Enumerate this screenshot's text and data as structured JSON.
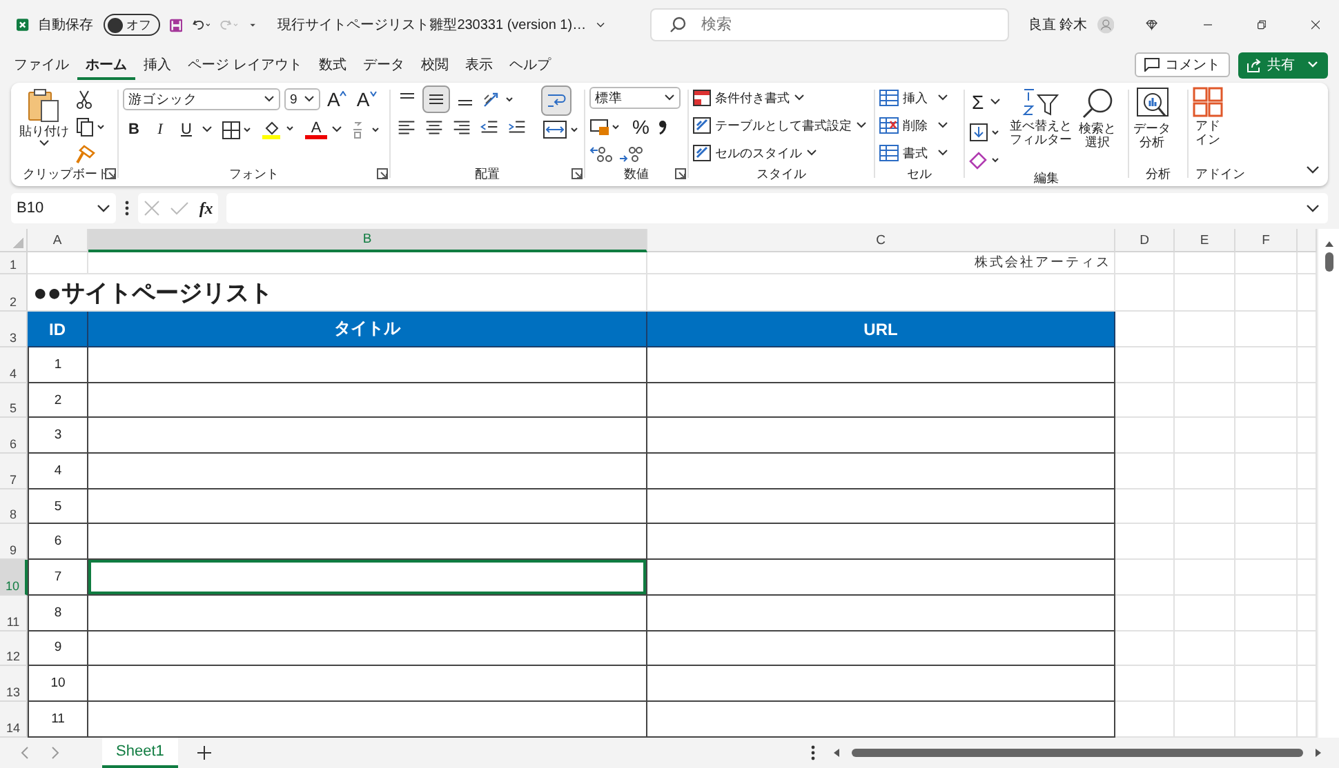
{
  "titlebar": {
    "autosave_label": "自動保存",
    "autosave": {
      "on": false,
      "label": "オフ"
    },
    "title": "現行サイトページリスト雛型230331 (version 1)…",
    "search": {
      "placeholder": "検索"
    },
    "user": "良直 鈴木"
  },
  "tabs": [
    {
      "label": "ファイル",
      "selected": false
    },
    {
      "label": "ホーム",
      "selected": true
    },
    {
      "label": "挿入",
      "selected": false
    },
    {
      "label": "ページ レイアウト",
      "selected": false
    },
    {
      "label": "数式",
      "selected": false
    },
    {
      "label": "データ",
      "selected": false
    },
    {
      "label": "校閲",
      "selected": false
    },
    {
      "label": "表示",
      "selected": false
    },
    {
      "label": "ヘルプ",
      "selected": false
    }
  ],
  "comment_button": "コメント",
  "share_button": "共有",
  "ribbon": {
    "clipboard": {
      "paste": "貼り付け",
      "label": "クリップボード"
    },
    "font": {
      "name": "游ゴシック",
      "size": "9",
      "grow": "A",
      "shrink": "A",
      "bold": "B",
      "italic": "I",
      "underline": "U",
      "font_color": "A",
      "label": "フォント"
    },
    "alignment": {
      "vertical": [
        {
          "selected": false
        },
        {
          "selected": true
        },
        {
          "selected": false
        }
      ],
      "wrap": {
        "selected": true
      },
      "label": "配置"
    },
    "number": {
      "format": "標準",
      "percent": "%",
      "label": "数値"
    },
    "styles": {
      "items": [
        "条件付き書式",
        "テーブルとして書式設定",
        "セルのスタイル"
      ],
      "label": "スタイル"
    },
    "cells": {
      "items": [
        "挿入",
        "削除",
        "書式"
      ],
      "label": "セル"
    },
    "editing": {
      "autosum": "Σ",
      "sort": "並べ替えとフィルター",
      "find": "検索と選択",
      "label": "編集"
    },
    "analysis": {
      "button": "データ分析",
      "label": "分析"
    },
    "addins": {
      "button": "アドイン",
      "label": "アドイン"
    }
  },
  "formula_bar": {
    "name_box": "B10",
    "fx": "fx"
  },
  "sheet": {
    "columns": [
      {
        "label": "A",
        "selected": false
      },
      {
        "label": "B",
        "selected": true
      },
      {
        "label": "C",
        "selected": false
      },
      {
        "label": "D",
        "selected": false
      },
      {
        "label": "E",
        "selected": false
      },
      {
        "label": "F",
        "selected": false
      }
    ],
    "row_headers": [
      {
        "label": "1",
        "selected": false
      },
      {
        "label": "2",
        "selected": false
      },
      {
        "label": "3",
        "selected": false
      },
      {
        "label": "4",
        "selected": false
      },
      {
        "label": "5",
        "selected": false
      },
      {
        "label": "6",
        "selected": false
      },
      {
        "label": "7",
        "selected": false
      },
      {
        "label": "8",
        "selected": false
      },
      {
        "label": "9",
        "selected": false
      },
      {
        "label": "10",
        "selected": true
      },
      {
        "label": "11",
        "selected": false
      },
      {
        "label": "12",
        "selected": false
      },
      {
        "label": "13",
        "selected": false
      },
      {
        "label": "14",
        "selected": false
      }
    ],
    "note": "株式会社アーティス",
    "heading": "●●サイトページリスト",
    "table": {
      "columns": [
        "ID",
        "タイトル",
        "URL"
      ],
      "rows": [
        {
          "id": "1",
          "active_cell": false
        },
        {
          "id": "2",
          "active_cell": false
        },
        {
          "id": "3",
          "active_cell": false
        },
        {
          "id": "4",
          "active_cell": false
        },
        {
          "id": "5",
          "active_cell": false
        },
        {
          "id": "6",
          "active_cell": false
        },
        {
          "id": "7",
          "active_cell": true
        },
        {
          "id": "8",
          "active_cell": false
        },
        {
          "id": "9",
          "active_cell": false
        },
        {
          "id": "10",
          "active_cell": false
        },
        {
          "id": "11",
          "active_cell": false
        }
      ]
    }
  },
  "sheet_tabs": [
    {
      "label": "Sheet1",
      "selected": true
    }
  ]
}
